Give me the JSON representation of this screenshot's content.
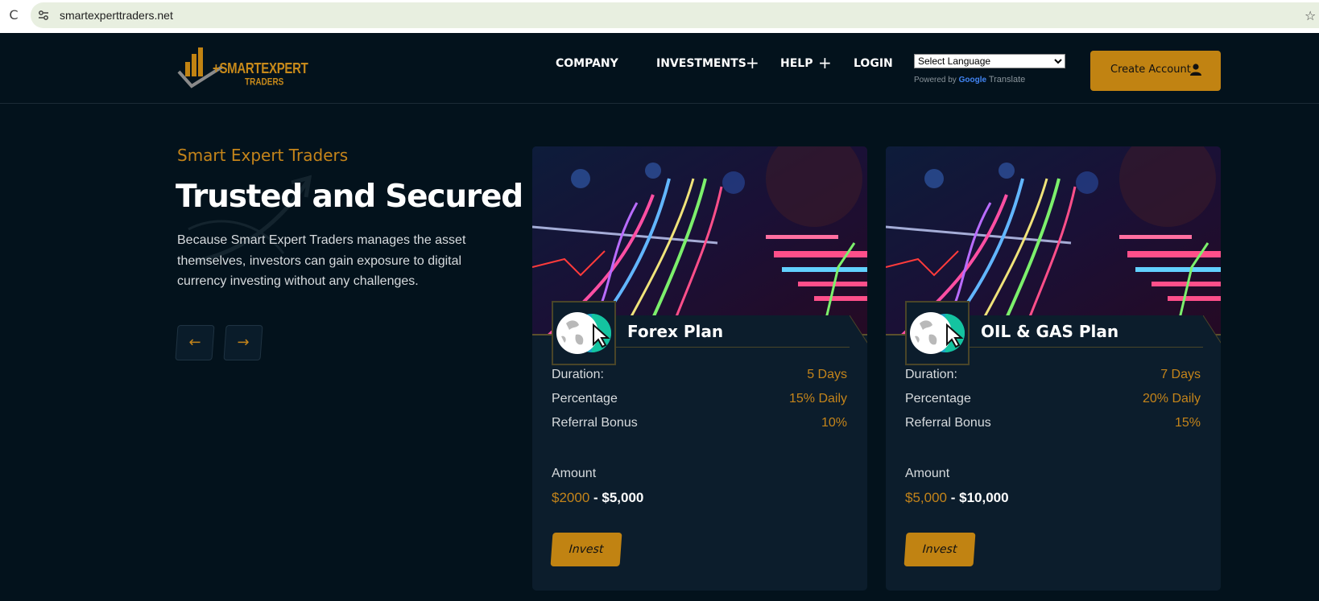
{
  "browser": {
    "url": "smartexperttraders.net",
    "reload_glyph": "C",
    "star_glyph": "☆"
  },
  "header": {
    "logo": {
      "line1": "+SMARTEXPERT",
      "line2": "TRADERS"
    },
    "nav": [
      {
        "label": "COMPANY",
        "has_plus": false
      },
      {
        "label": "INVESTMENTS",
        "has_plus": true
      },
      {
        "label": "HELP",
        "has_plus": true
      },
      {
        "label": "LOGIN",
        "has_plus": false
      }
    ],
    "plus_glyph": "+",
    "language_select": {
      "value": "Select Language",
      "caret": "⌄"
    },
    "powered_by": {
      "prefix": "Powered by",
      "brand": "Google",
      "suffix": "Translate"
    },
    "create_account": "Create Account"
  },
  "hero": {
    "subtitle": "Smart Expert Traders",
    "title": "Trusted and Secured",
    "text": "Because Smart Expert Traders manages the asset themselves, investors can gain exposure to digital currency investing without any challenges.",
    "prev_glyph": "←",
    "next_glyph": "→"
  },
  "plans": [
    {
      "name": "Forex Plan",
      "rows": [
        {
          "label": "Duration:",
          "value": "5 Days"
        },
        {
          "label": "Percentage",
          "value": "15% Daily"
        },
        {
          "label": "Referral Bonus",
          "value": "10%"
        }
      ],
      "amount_label": "Amount",
      "amount_min": "$2000",
      "amount_sep": " - ",
      "amount_max": "$5,000",
      "invest_label": "Invest"
    },
    {
      "name": "OIL & GAS Plan",
      "rows": [
        {
          "label": "Duration:",
          "value": "7 Days"
        },
        {
          "label": "Percentage",
          "value": "20% Daily"
        },
        {
          "label": "Referral Bonus",
          "value": "15%"
        }
      ],
      "amount_label": "Amount",
      "amount_min": "$5,000",
      "amount_sep": " - ",
      "amount_max": "$10,000",
      "invest_label": "Invest"
    }
  ],
  "colors": {
    "background": "#03121c",
    "card": "#0c1d2c",
    "accent": "#c18312",
    "accent_text": "#c4841a"
  }
}
